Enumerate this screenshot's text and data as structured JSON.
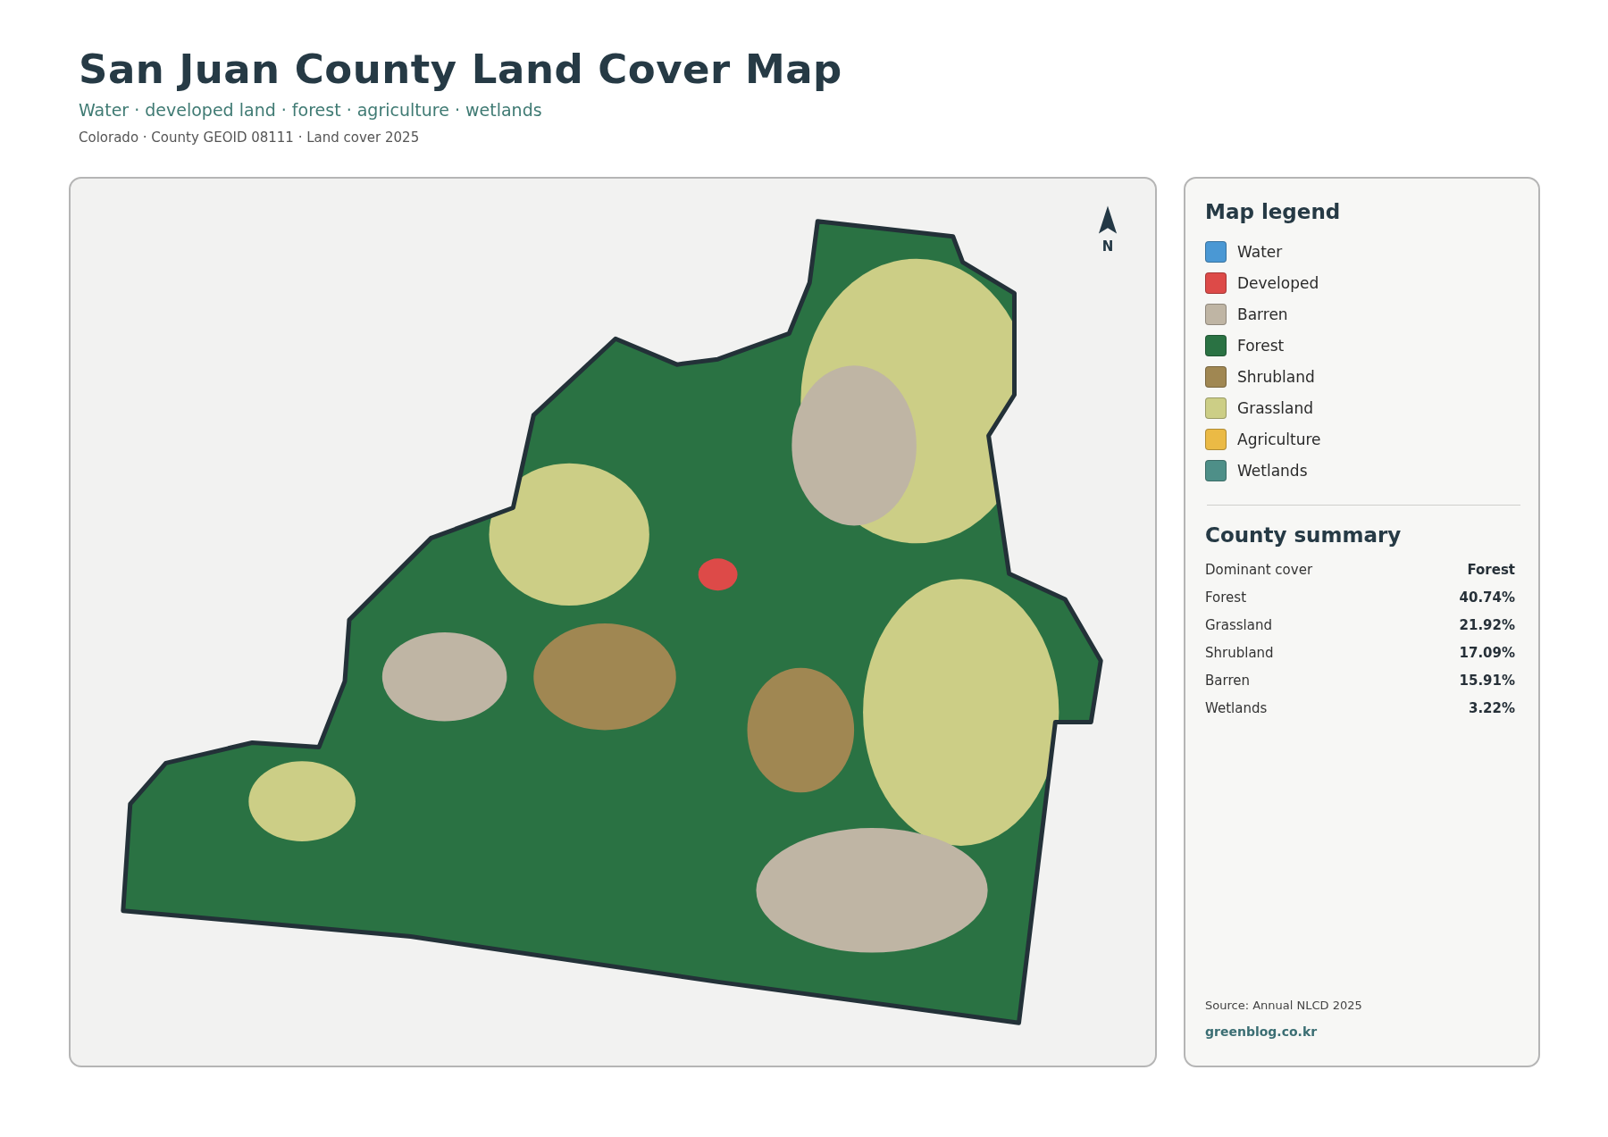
{
  "header": {
    "title": "San Juan County Land Cover Map",
    "subtitle": "Water · developed land · forest · agriculture · wetlands",
    "meta": "Colorado · County GEOID 08111 · Land cover 2025"
  },
  "map": {
    "kind": "picture",
    "north_label": "N"
  },
  "legend": {
    "title": "Map legend",
    "items": [
      {
        "label": "Water",
        "color": "#4a98d4"
      },
      {
        "label": "Developed",
        "color": "#dd4a48"
      },
      {
        "label": "Barren",
        "color": "#bfb5a4"
      },
      {
        "label": "Forest",
        "color": "#2a7243"
      },
      {
        "label": "Shrubland",
        "color": "#a08752"
      },
      {
        "label": "Grassland",
        "color": "#ccce86"
      },
      {
        "label": "Agriculture",
        "color": "#ebba45"
      },
      {
        "label": "Wetlands",
        "color": "#4e8f88"
      }
    ]
  },
  "summary": {
    "title": "County summary",
    "rows": [
      {
        "label": "Dominant cover",
        "value": "Forest"
      },
      {
        "label": "Forest",
        "value": "40.74%"
      },
      {
        "label": "Grassland",
        "value": "21.92%"
      },
      {
        "label": "Shrubland",
        "value": "17.09%"
      },
      {
        "label": "Barren",
        "value": "15.91%"
      },
      {
        "label": "Wetlands",
        "value": "3.22%"
      }
    ]
  },
  "source": "Source: Annual NLCD 2025",
  "site": "greenblog.co.kr"
}
